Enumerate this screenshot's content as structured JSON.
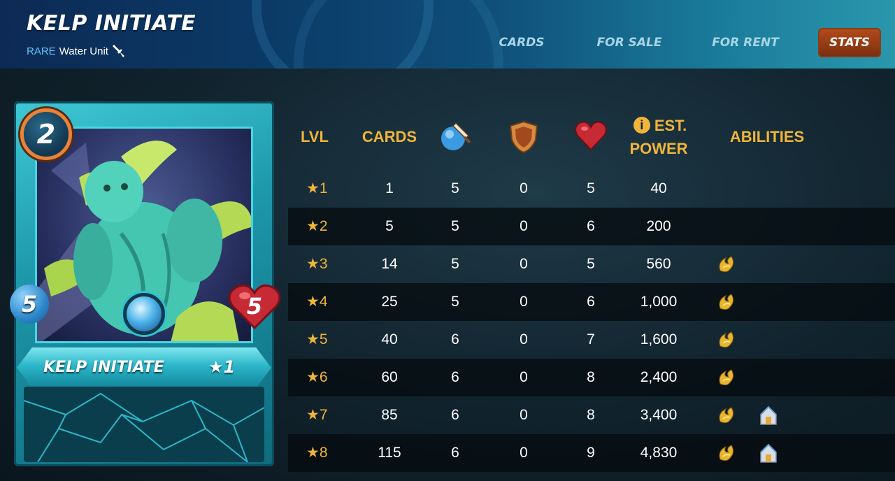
{
  "header": {
    "title": "KELP INITIATE",
    "rarity": "RARE",
    "unit_type": "Water Unit",
    "nav": [
      {
        "label": "CARDS",
        "active": false
      },
      {
        "label": "FOR SALE",
        "active": false
      },
      {
        "label": "FOR RENT",
        "active": false
      },
      {
        "label": "STATS",
        "active": true
      }
    ]
  },
  "card": {
    "name": "KELP INITIATE",
    "level": "1",
    "mana": "2",
    "attack": "5",
    "health": "5",
    "element": "water",
    "frame_color": "#2bb6c9"
  },
  "table": {
    "headers": {
      "lvl": "LVL",
      "cards": "CARDS",
      "attack_icon": "melee-attack-icon",
      "armor_icon": "armor-shield-icon",
      "health_icon": "health-heart-icon",
      "est": "EST.",
      "power": "POWER",
      "abilities": "ABILITIES"
    },
    "rows": [
      {
        "lvl": "1",
        "cards": "1",
        "attack": "5",
        "armor": "0",
        "health": "5",
        "power": "40",
        "abilities": []
      },
      {
        "lvl": "2",
        "cards": "5",
        "attack": "5",
        "armor": "0",
        "health": "6",
        "power": "200",
        "abilities": []
      },
      {
        "lvl": "3",
        "cards": "14",
        "attack": "5",
        "armor": "0",
        "health": "5",
        "power": "560",
        "abilities": [
          "ability-swiftness-icon"
        ]
      },
      {
        "lvl": "4",
        "cards": "25",
        "attack": "5",
        "armor": "0",
        "health": "6",
        "power": "1,000",
        "abilities": [
          "ability-swiftness-icon"
        ]
      },
      {
        "lvl": "5",
        "cards": "40",
        "attack": "6",
        "armor": "0",
        "health": "7",
        "power": "1,600",
        "abilities": [
          "ability-swiftness-icon"
        ]
      },
      {
        "lvl": "6",
        "cards": "60",
        "attack": "6",
        "armor": "0",
        "health": "8",
        "power": "2,400",
        "abilities": [
          "ability-swiftness-icon"
        ]
      },
      {
        "lvl": "7",
        "cards": "85",
        "attack": "6",
        "armor": "0",
        "health": "8",
        "power": "3,400",
        "abilities": [
          "ability-swiftness-icon",
          "ability-shelter-icon"
        ]
      },
      {
        "lvl": "8",
        "cards": "115",
        "attack": "6",
        "armor": "0",
        "health": "9",
        "power": "4,830",
        "abilities": [
          "ability-swiftness-icon",
          "ability-shelter-icon"
        ]
      }
    ]
  },
  "colors": {
    "accent_gold": "#f0b43b",
    "active_tab": "#b34c1c",
    "rarity_blue": "#5ec8ff"
  }
}
